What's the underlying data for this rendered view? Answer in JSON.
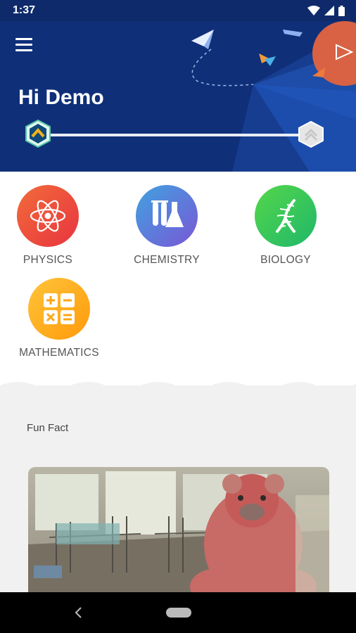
{
  "status_bar": {
    "time": "1:37"
  },
  "header": {
    "greeting": "Hi Demo",
    "progress": 1.0
  },
  "subjects": [
    {
      "label": "PHYSICS",
      "icon": "atom-icon"
    },
    {
      "label": "CHEMISTRY",
      "icon": "test-tubes-flask-icon"
    },
    {
      "label": "BIOLOGY",
      "icon": "dna-icon"
    },
    {
      "label": "MATHEMATICS",
      "icon": "calculator-icon"
    }
  ],
  "fun_fact": {
    "title": "Fun Fact",
    "image": "abandoned-room-teddy-bear-photo"
  },
  "colors": {
    "header_bg": "#0f2f78",
    "physics": "#f04e3b",
    "chemistry": "#5b73d8",
    "biology": "#33c65a",
    "mathematics": "#ffab1a"
  }
}
